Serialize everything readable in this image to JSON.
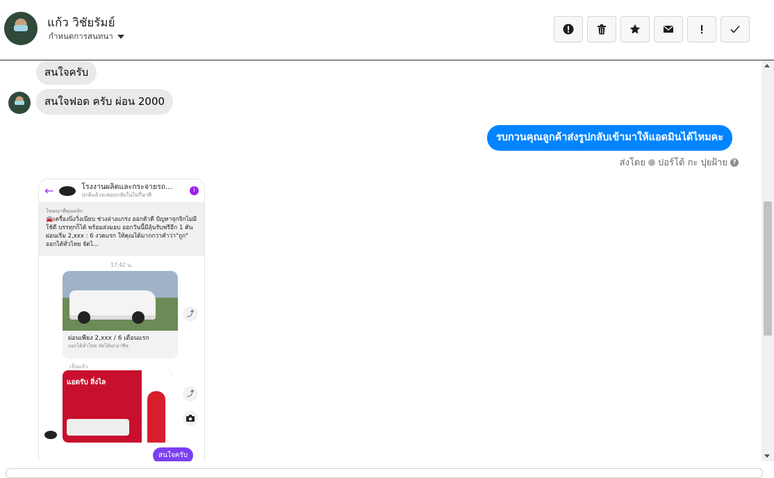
{
  "header": {
    "name": "แก้ว วิชัยรัมย์",
    "subtitle": "กำหนดการสนทนา",
    "actions": [
      "report-icon",
      "trash-icon",
      "star-icon",
      "mail-icon",
      "important-icon",
      "check-icon"
    ]
  },
  "messages": [
    {
      "side": "left",
      "text": "สนใจครับ"
    },
    {
      "side": "left",
      "text": "สนใจฟอด ครับ ผ่อน 2000"
    },
    {
      "side": "right",
      "text": "รบกวนคุณลูกค้าส่งรูปกลับเข้ามาให้แอดมินได้ไหมคะ"
    }
  ],
  "sent_by": "ส่งโดย",
  "sent_by_name": "ปอร์โต้ กะ ปุยฝ้าย",
  "phone": {
    "title": "โรงงานผลิตและกระจายรถ...",
    "subtitle": "ปกติแล้วจะตอบกลับในไม่กี่นาที",
    "ad_label": "โฆษณาที่คุณคลิก",
    "ad_text": "🚘เครื่องนิ่งวิ่งเนียบ ช่วงล่างแกร่ง ออกตัวดี ปัญหาจุกจิกไม่มี ใช้ดี บรรทุกก็ได้ พร้อมส่งมอบ ออกวันนี้มีลุ้นรับฟรีอีก 1 คัน ผ่อนเริ่ม 2,xxx : 6 งวดแรก ให้คุณได้มากกว่าคำว่า\"ถูก\" ออกได้ทั่วไทย จัดไ...",
    "time": "17:42 น.",
    "card_title": "ผ่อนเพียง 2,xxx / 6 เดือนแรก",
    "card_sub": "ออกได้ทั่วไทย จัดได้ทุกอาชีพ",
    "sent_label": "เห็นแล้ว",
    "promo": "แอดรับ สิ่งไล",
    "reply": "สนใจครับ"
  }
}
